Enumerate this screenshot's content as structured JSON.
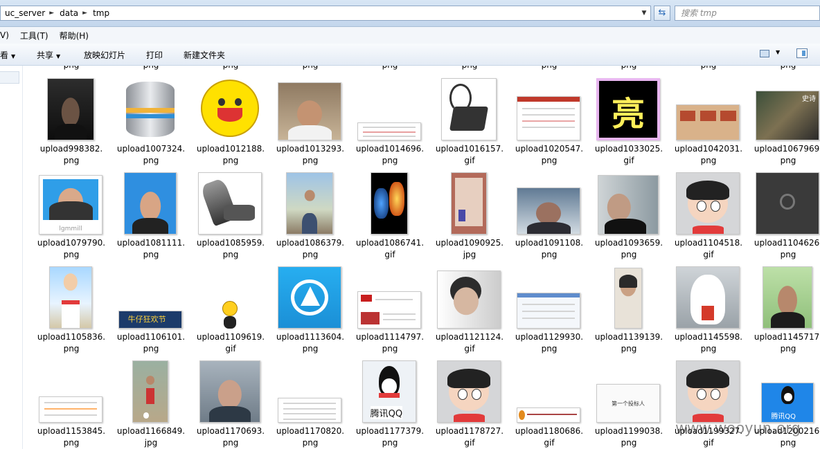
{
  "address": {
    "crumbs": [
      "uc_server",
      "data",
      "tmp"
    ],
    "search_placeholder": "搜索 tmp"
  },
  "menu": [
    "V)",
    "工具(T)",
    "帮助(H)"
  ],
  "toolbar": {
    "organize_fragment": "看",
    "share": "共享",
    "slideshow": "放映幻灯片",
    "print": "打印",
    "new_folder": "新建文件夹"
  },
  "prev_row_ext": [
    "png",
    "png",
    "png",
    "png",
    "png",
    "png",
    "png",
    "png",
    "png",
    "png",
    "png"
  ],
  "files": [
    {
      "name": "upload998382.",
      "ext": "png",
      "thumb": "photo-dark-man"
    },
    {
      "name": "upload1007324.",
      "ext": "png",
      "thumb": "database-icon"
    },
    {
      "name": "upload1012188.",
      "ext": "png",
      "thumb": "smiley-face"
    },
    {
      "name": "upload1013293.",
      "ext": "png",
      "thumb": "photo-man-headband"
    },
    {
      "name": "upload1014696.",
      "ext": "png",
      "thumb": "document-small"
    },
    {
      "name": "upload1016157.",
      "ext": "gif",
      "thumb": "telephone-headset"
    },
    {
      "name": "upload1020547.",
      "ext": "png",
      "thumb": "webpage-screenshot"
    },
    {
      "name": "upload1033025.",
      "ext": "gif",
      "thumb": "liang-character"
    },
    {
      "name": "upload1042031.",
      "ext": "png",
      "thumb": "game-screenshot"
    },
    {
      "name": "upload1067969.",
      "ext": "png",
      "thumb": "game-warrior"
    },
    {
      "name": "upload1079790.",
      "ext": "png",
      "thumb": "id-photo-blue"
    },
    {
      "name": "upload1081111.",
      "ext": "png",
      "thumb": "id-photo-young-man"
    },
    {
      "name": "upload1085959.",
      "ext": "png",
      "thumb": "massage-chair"
    },
    {
      "name": "upload1086379.",
      "ext": "png",
      "thumb": "photo-outdoor-man"
    },
    {
      "name": "upload1086741.",
      "ext": "gif",
      "thumb": "fire-ice-hands"
    },
    {
      "name": "upload1090925.",
      "ext": "jpg",
      "thumb": "red-document"
    },
    {
      "name": "upload1091108.",
      "ext": "png",
      "thumb": "photo-man-webcam"
    },
    {
      "name": "upload1093659.",
      "ext": "png",
      "thumb": "photo-man-dark-suit"
    },
    {
      "name": "upload1104518.",
      "ext": "gif",
      "thumb": "cartoon-boy"
    },
    {
      "name": "upload1104626.",
      "ext": "png",
      "thumb": "chrome-dark"
    },
    {
      "name": "upload1105836.",
      "ext": "png",
      "thumb": "cartoon-salute"
    },
    {
      "name": "upload1106101.",
      "ext": "png",
      "thumb": "banner-festival"
    },
    {
      "name": "upload1109619.",
      "ext": "gif",
      "thumb": "small-emoji"
    },
    {
      "name": "upload1113604.",
      "ext": "png",
      "thumb": "app-icon-blue"
    },
    {
      "name": "upload1114797.",
      "ext": "png",
      "thumb": "business-card"
    },
    {
      "name": "upload1121124.",
      "ext": "gif",
      "thumb": "photo-smoking-man"
    },
    {
      "name": "upload1129930.",
      "ext": "png",
      "thumb": "webpage-form"
    },
    {
      "name": "upload1139139.",
      "ext": "png",
      "thumb": "photo-woman"
    },
    {
      "name": "upload1145598.",
      "ext": "png",
      "thumb": "baymax"
    },
    {
      "name": "upload1145717.",
      "ext": "png",
      "thumb": "id-photo-green"
    },
    {
      "name": "upload1153845.",
      "ext": "png",
      "thumb": "document-strip"
    },
    {
      "name": "upload1166849.",
      "ext": "jpg",
      "thumb": "photo-child-soccer"
    },
    {
      "name": "upload1170693.",
      "ext": "png",
      "thumb": "photo-young-man"
    },
    {
      "name": "upload1170820.",
      "ext": "png",
      "thumb": "table-screenshot"
    },
    {
      "name": "upload1177379.",
      "ext": "png",
      "thumb": "tencent-qq-shortcut"
    },
    {
      "name": "upload1178727.",
      "ext": "gif",
      "thumb": "cartoon-boy"
    },
    {
      "name": "upload1180686.",
      "ext": "gif",
      "thumb": "company-logo-banner"
    },
    {
      "name": "upload1199038.",
      "ext": "png",
      "thumb": "text-card"
    },
    {
      "name": "upload1199327.",
      "ext": "gif",
      "thumb": "cartoon-boy"
    },
    {
      "name": "upload1200216.",
      "ext": "png",
      "thumb": "tencent-qq-blue"
    }
  ],
  "thumb_text": {
    "liang": "亮",
    "qq_label": "腾讯QQ",
    "festival": "牛仔狂欢节",
    "text_card": "第一个投标人",
    "id_caption": "lgmmill",
    "game_title": "史诗"
  },
  "watermark": "www.wooyun.org"
}
